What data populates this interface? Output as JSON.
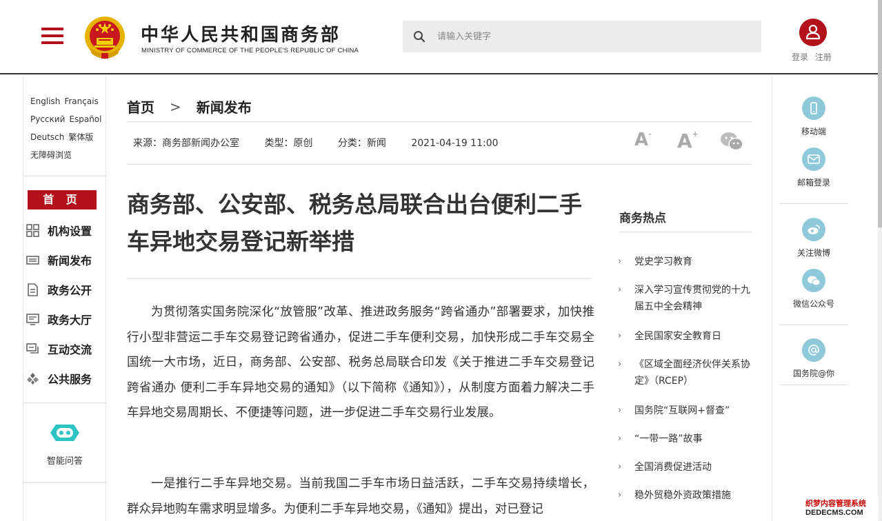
{
  "header": {
    "title_cn": "中华人民共和国商务部",
    "title_en": "MINISTRY OF COMMERCE OF THE PEOPLE'S REPUBLIC OF CHINA",
    "search_placeholder": "请输入关键字",
    "login": "登录",
    "register": "注册"
  },
  "languages": [
    [
      "English",
      "Français"
    ],
    [
      "Русский",
      "Español"
    ],
    [
      "Deutsch",
      "繁体版"
    ],
    [
      "无障碍浏览"
    ]
  ],
  "left_nav": {
    "home": "首 页",
    "items": [
      {
        "label": "机构设置",
        "icon": "org-grid-icon"
      },
      {
        "label": "新闻发布",
        "icon": "news-icon"
      },
      {
        "label": "政务公开",
        "icon": "document-icon"
      },
      {
        "label": "政务大厅",
        "icon": "monitor-icon"
      },
      {
        "label": "互动交流",
        "icon": "chat-icon"
      },
      {
        "label": "公共服务",
        "icon": "service-icon"
      }
    ],
    "bot_label": "智能问答"
  },
  "breadcrumb": {
    "home": "首页",
    "separator": ">",
    "current": "新闻发布"
  },
  "meta": {
    "source": "来源：商务部新闻办公室",
    "type": "类型：原创",
    "category": "分类：新闻",
    "date": "2021-04-19 11:00"
  },
  "font_controls": {
    "smaller": "A",
    "smaller_sup": "-",
    "larger": "A",
    "larger_sup": "+"
  },
  "article": {
    "title": "商务部、公安部、税务总局联合出台便利二手车异地交易登记新举措",
    "paragraphs": [
      "为贯彻落实国务院深化“放管服”改革、推进政务服务“跨省通办”部署要求，加快推行小型非营运二手车交易登记跨省通办，促进二手车便利交易，加快形成二手车交易全国统一大市场，近日，商务部、公安部、税务总局联合印发《关于推进二手车交易登记跨省通办 便利二手车异地交易的通知》（以下简称《通知》），从制度方面着力解决二手车异地交易周期长、不便捷等问题，进一步促进二手车交易行业发展。",
      "一是推行二手车异地交易。当前我国二手车市场日益活跃，二手车交易持续增长，群众异地购车需求明显增多。为便利二手车异地交易，《通知》提出，对已登记"
    ]
  },
  "hot": {
    "title": "商务热点",
    "items": [
      "党史学习教育",
      "深入学习宣传贯彻党的十九届五中全会精神",
      "全民国家安全教育日",
      "《区域全面经济伙伴关系协定》（RCEP）",
      "国务院“互联网+督查”",
      "“一带一路”故事",
      "全国消费促进活动",
      "稳外贸稳外资政策措施"
    ]
  },
  "right_sidebar": [
    {
      "label": "移动端",
      "icon": "mobile-icon"
    },
    {
      "label": "邮箱登录",
      "icon": "mail-icon"
    },
    {
      "label": "关注微博",
      "icon": "weibo-icon"
    },
    {
      "label": "微信公众号",
      "icon": "wechat-icon"
    },
    {
      "label": "国务院@你",
      "icon": "at-icon"
    }
  ],
  "watermark": {
    "line1": "织梦内容管理系统",
    "line2": "DEDECMS.COM"
  },
  "colors": {
    "brand_red": "#b3121a",
    "icon_teal": "#8fc8d8"
  }
}
